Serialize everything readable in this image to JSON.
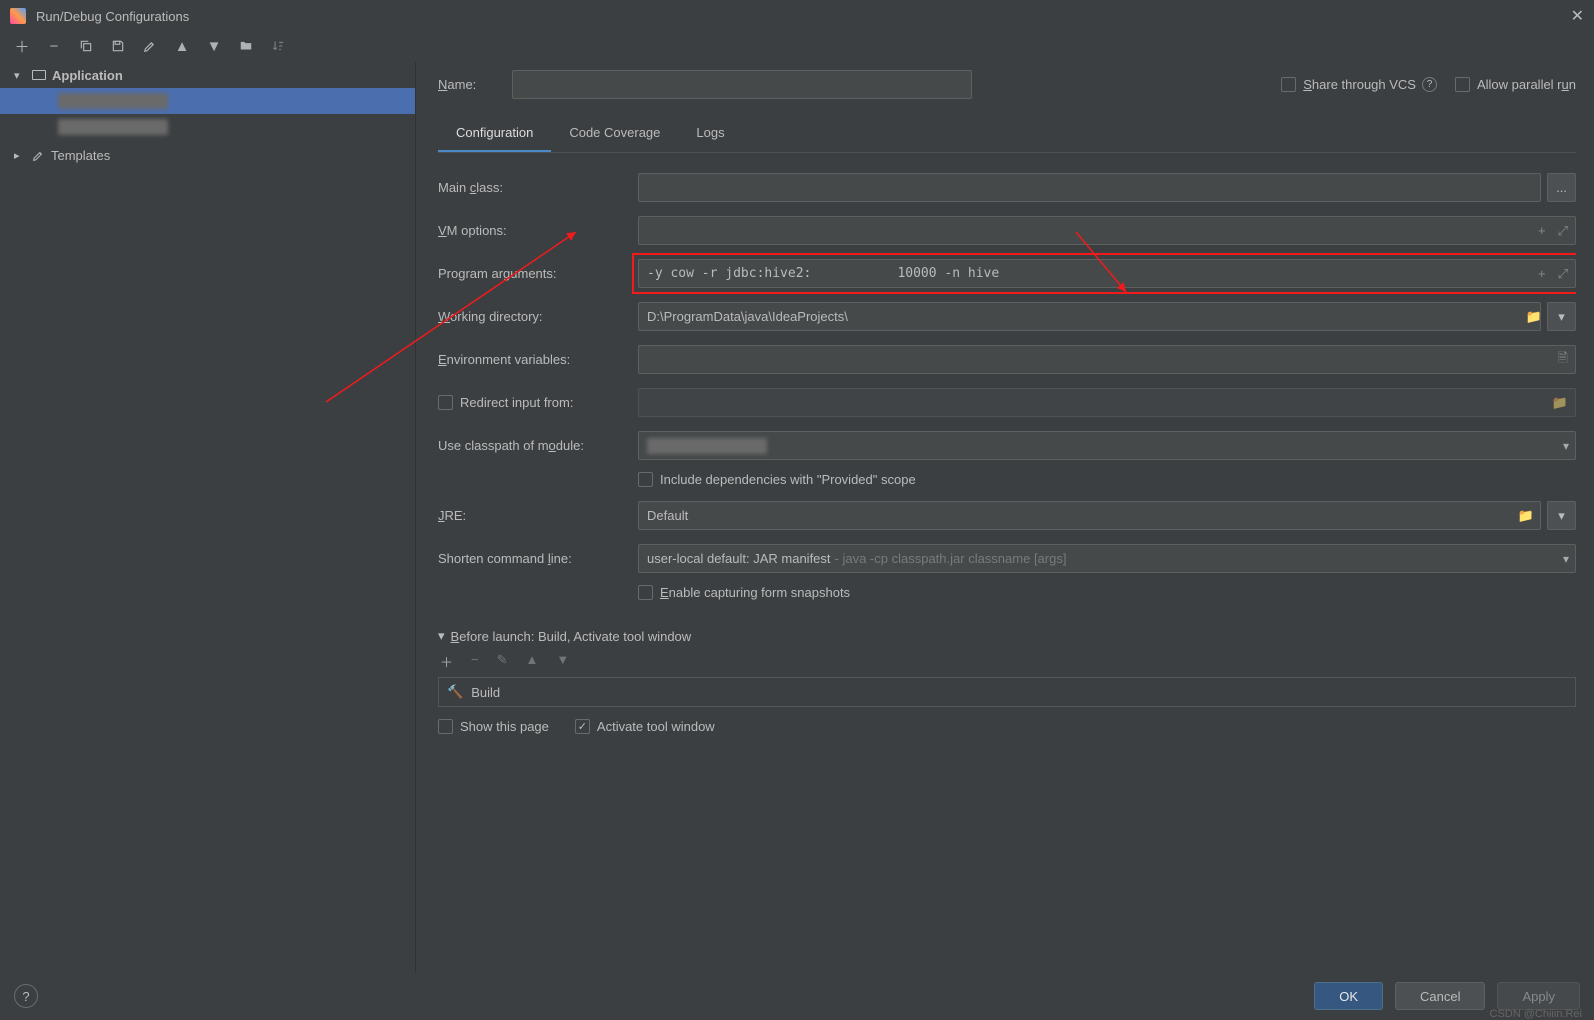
{
  "window_title": "Run/Debug Configurations",
  "tree": {
    "root": "Application",
    "templates": "Templates"
  },
  "name_label": "Name:",
  "share_vcs": "Share through VCS",
  "allow_parallel": "Allow parallel run",
  "tabs": {
    "config": "Configuration",
    "coverage": "Code Coverage",
    "logs": "Logs"
  },
  "labels": {
    "main_class": "Main class:",
    "vm_options": "VM options:",
    "prog_args": "Program arguments:",
    "working_dir": "Working directory:",
    "env_vars": "Environment variables:",
    "redirect": "Redirect input from:",
    "classpath": "Use classpath of module:",
    "include_dep": "Include dependencies with \"Provided\" scope",
    "jre": "JRE:",
    "shorten": "Shorten command line:",
    "enable_snap": "Enable capturing form snapshots",
    "before_launch": "Before launch: Build, Activate tool window",
    "build": "Build",
    "show_page": "Show this page",
    "activate_tool": "Activate tool window"
  },
  "values": {
    "prog_args": "-y cow -r jdbc:hive2:           10000 -n hive",
    "working_dir": "D:\\ProgramData\\java\\IdeaProjects\\",
    "jre": "Default",
    "shorten_main": "user-local default: JAR manifest",
    "shorten_grey": " - java -cp classpath.jar classname [args]"
  },
  "footer": {
    "ok": "OK",
    "cancel": "Cancel",
    "apply": "Apply"
  },
  "watermark": "CSDN @Chiiin.Rei",
  "browse_dots": "..."
}
